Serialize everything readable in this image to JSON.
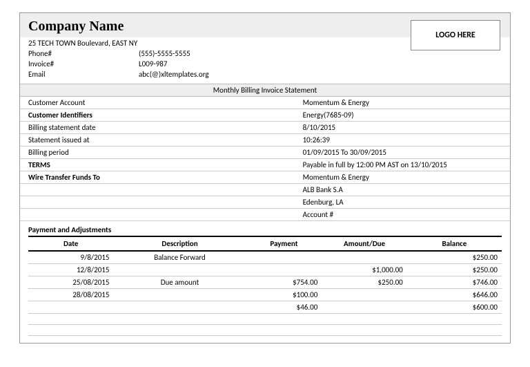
{
  "header": {
    "company_name": "Company Name",
    "logo_text": "LOGO HERE",
    "address": "25 TECH TOWN Boulevard, EAST NY",
    "phone_label": "Phone#",
    "phone_value": "(555)-5555-5555",
    "invoice_label": "Invoice#",
    "invoice_value": "L009-987",
    "email_label": "Email",
    "email_value": "abc(@)xltemplates.org"
  },
  "section_title": "Monthly Billing Invoice Statement",
  "details": [
    {
      "label": "Customer Account",
      "value": "Momentum & Energy",
      "bold": false
    },
    {
      "label": "Customer Identifiers",
      "value": "Energy(7685-09)",
      "bold": true
    },
    {
      "label": "Billing statement date",
      "value": "8/10/2015",
      "bold": false
    },
    {
      "label": "Statement issued at",
      "value": "10:26:39",
      "bold": false
    },
    {
      "label": "Billing period",
      "value": "01/09/2015 To 30/09/2015",
      "bold": false
    },
    {
      "label": "TERMS",
      "value": "Payable in full by 12:00 PM AST on 13/10/2015",
      "bold": true
    },
    {
      "label": "Wire Transfer Funds To",
      "value": "Momentum & Energy",
      "bold": true
    },
    {
      "label": "",
      "value": "ALB Bank S.A",
      "bold": false
    },
    {
      "label": "",
      "value": "Edenburg, LA",
      "bold": false
    },
    {
      "label": "",
      "value": "Account #",
      "bold": false
    }
  ],
  "payments_title": "Payment and Adjustments",
  "payments_headers": {
    "date": "Date",
    "description": "Description",
    "payment": "Payment",
    "amount": "Amount/Due",
    "balance": "Balance"
  },
  "payments_rows": [
    {
      "date": "9/8/2015",
      "description": "Balance Forward",
      "payment": "",
      "amount": "",
      "balance": "$250.00"
    },
    {
      "date": "12/8/2015",
      "description": "",
      "payment": "",
      "amount": "$1,000.00",
      "balance": "$250.00"
    },
    {
      "date": "25/08/2015",
      "description": "Due amount",
      "payment": "$754.00",
      "amount": "$250.00",
      "balance": "$746.00"
    },
    {
      "date": "28/08/2015",
      "description": "",
      "payment": "$100.00",
      "amount": "",
      "balance": "$646.00"
    },
    {
      "date": "",
      "description": "",
      "payment": "$46.00",
      "amount": "",
      "balance": "$600.00"
    },
    {
      "date": "",
      "description": "",
      "payment": "",
      "amount": "",
      "balance": ""
    },
    {
      "date": "",
      "description": "",
      "payment": "",
      "amount": "",
      "balance": ""
    }
  ],
  "chart_data": {
    "type": "table",
    "title": "Payment and Adjustments",
    "columns": [
      "Date",
      "Description",
      "Payment",
      "Amount/Due",
      "Balance"
    ],
    "rows": [
      [
        "9/8/2015",
        "Balance Forward",
        "",
        "",
        "$250.00"
      ],
      [
        "12/8/2015",
        "",
        "",
        "$1,000.00",
        "$250.00"
      ],
      [
        "25/08/2015",
        "Due amount",
        "$754.00",
        "$250.00",
        "$746.00"
      ],
      [
        "28/08/2015",
        "",
        "$100.00",
        "",
        "$646.00"
      ],
      [
        "",
        "",
        "$46.00",
        "",
        "$600.00"
      ]
    ]
  }
}
